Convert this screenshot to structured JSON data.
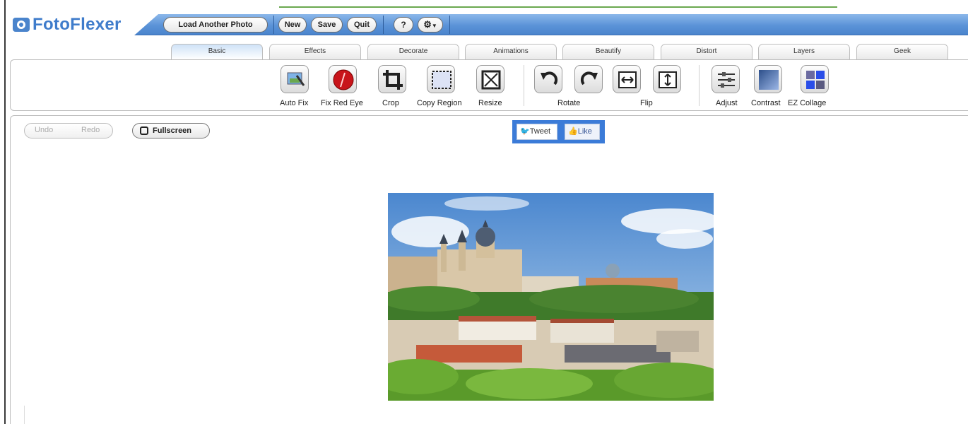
{
  "app": {
    "logo_text": "FotoFlexer",
    "accent": "#4a84cc"
  },
  "toolbar": {
    "load_another_photo": "Load Another Photo",
    "new": "New",
    "save": "Save",
    "quit": "Quit",
    "help": "?",
    "settings_icon": "gear-icon"
  },
  "tabs": [
    "Basic",
    "Effects",
    "Decorate",
    "Animations",
    "Beautify",
    "Distort",
    "Layers",
    "Geek"
  ],
  "active_tab": "Basic",
  "tools": {
    "auto_fix": "Auto Fix",
    "fix_red_eye": "Fix Red Eye",
    "crop": "Crop",
    "copy_region": "Copy Region",
    "resize": "Resize",
    "rotate": "Rotate",
    "flip": "Flip",
    "adjust": "Adjust",
    "contrast": "Contrast",
    "ez_collage": "EZ Collage"
  },
  "content": {
    "undo": "Undo",
    "redo": "Redo",
    "fullscreen": "Fullscreen",
    "tweet": "Tweet",
    "like": "Like"
  }
}
